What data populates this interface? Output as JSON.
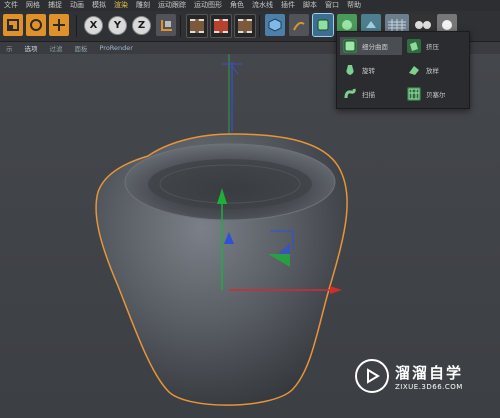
{
  "menu": {
    "items": [
      "文件",
      "网格",
      "捕捉",
      "动画",
      "模拟",
      "渲染",
      "雕刻",
      "运动跟踪",
      "运动图形",
      "角色",
      "流水线",
      "插件",
      "脚本",
      "窗口",
      "帮助"
    ],
    "highlighted": 4
  },
  "toolbar": {
    "axis_x": "X",
    "axis_y": "Y",
    "axis_z": "Z",
    "icons": [
      "select-icon",
      "rotate-icon",
      "move-icon",
      "x-axis-icon",
      "y-axis-icon",
      "z-axis-icon",
      "coordinate-system-icon",
      "render-view-icon",
      "render-icon",
      "render-settings-icon",
      "cube-primitive-icon",
      "spline-pen-icon",
      "subdivision-surface-icon",
      "generator-icon",
      "deformer-icon",
      "floor-icon",
      "camera-icon",
      "light-icon"
    ]
  },
  "subbar": {
    "items": [
      "示",
      "选项",
      "过滤",
      "面板",
      "ProRender"
    ],
    "active": 1
  },
  "popup": {
    "items": [
      {
        "label": "细分曲面",
        "icon": "subdivision-surface-icon",
        "active": true
      },
      {
        "label": "挤压",
        "icon": "extrude-icon",
        "active": false
      },
      {
        "label": "旋转",
        "icon": "lathe-icon",
        "active": false
      },
      {
        "label": "放样",
        "icon": "loft-icon",
        "active": false
      },
      {
        "label": "扫描",
        "icon": "sweep-icon",
        "active": false
      },
      {
        "label": "贝塞尔",
        "icon": "bezier-icon",
        "active": false
      }
    ]
  },
  "watermark": {
    "title": "溜溜自学",
    "subtitle": "ZIXUE.3D66.COM"
  },
  "colors": {
    "menu_bg": "#2c2e31",
    "toolbar_bg": "#2f3134",
    "viewport_bg": "#42454a",
    "axis_x": "#d22c2c",
    "axis_y": "#1fae3a",
    "axis_z": "#2f50d8",
    "selection_outline": "#e6953a"
  }
}
